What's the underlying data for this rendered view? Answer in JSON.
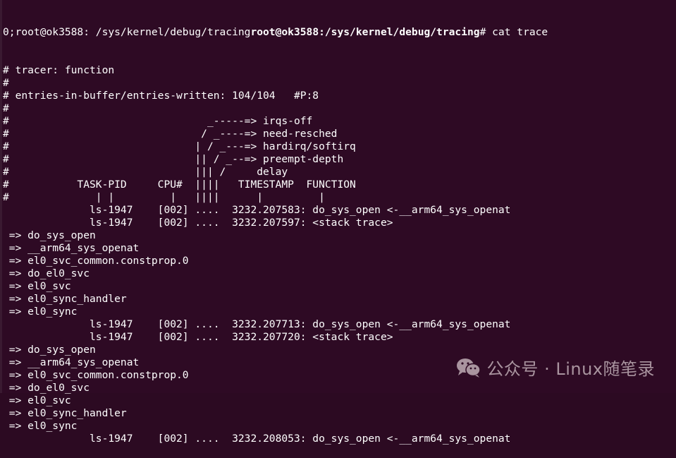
{
  "terminal": {
    "prompt_prefix": "0;root@ok3588: /sys/kernel/debug/tracing",
    "prompt_user_host": "root@ok3588",
    "prompt_path": ":/sys/kernel/debug/tracing",
    "prompt_symbol": "# ",
    "command": "cat trace",
    "lines": [
      "# tracer: function",
      "#",
      "# entries-in-buffer/entries-written: 104/104   #P:8",
      "#",
      "#                                _-----=> irqs-off",
      "#                               / _----=> need-resched",
      "#                              | / _---=> hardirq/softirq",
      "#                              || / _--=> preempt-depth",
      "#                              ||| /     delay",
      "#           TASK-PID     CPU#  ||||   TIMESTAMP  FUNCTION",
      "#              | |         |   ||||      |         |",
      "              ls-1947    [002] ....  3232.207583: do_sys_open <-__arm64_sys_openat",
      "              ls-1947    [002] ....  3232.207597: <stack trace>",
      " => do_sys_open",
      " => __arm64_sys_openat",
      " => el0_svc_common.constprop.0",
      " => do_el0_svc",
      " => el0_svc",
      " => el0_sync_handler",
      " => el0_sync",
      "              ls-1947    [002] ....  3232.207713: do_sys_open <-__arm64_sys_openat",
      "              ls-1947    [002] ....  3232.207720: <stack trace>",
      " => do_sys_open",
      " => __arm64_sys_openat",
      " => el0_svc_common.constprop.0",
      " => do_el0_svc",
      " => el0_svc",
      " => el0_sync_handler",
      " => el0_sync",
      "              ls-1947    [002] ....  3232.208053: do_sys_open <-__arm64_sys_openat"
    ]
  },
  "watermark": {
    "icon": "wechat-icon",
    "text": "公众号 · Linux随笔录"
  },
  "colors": {
    "background": "#2e0a24",
    "foreground": "#ffffff",
    "watermark": "#a9949f"
  }
}
